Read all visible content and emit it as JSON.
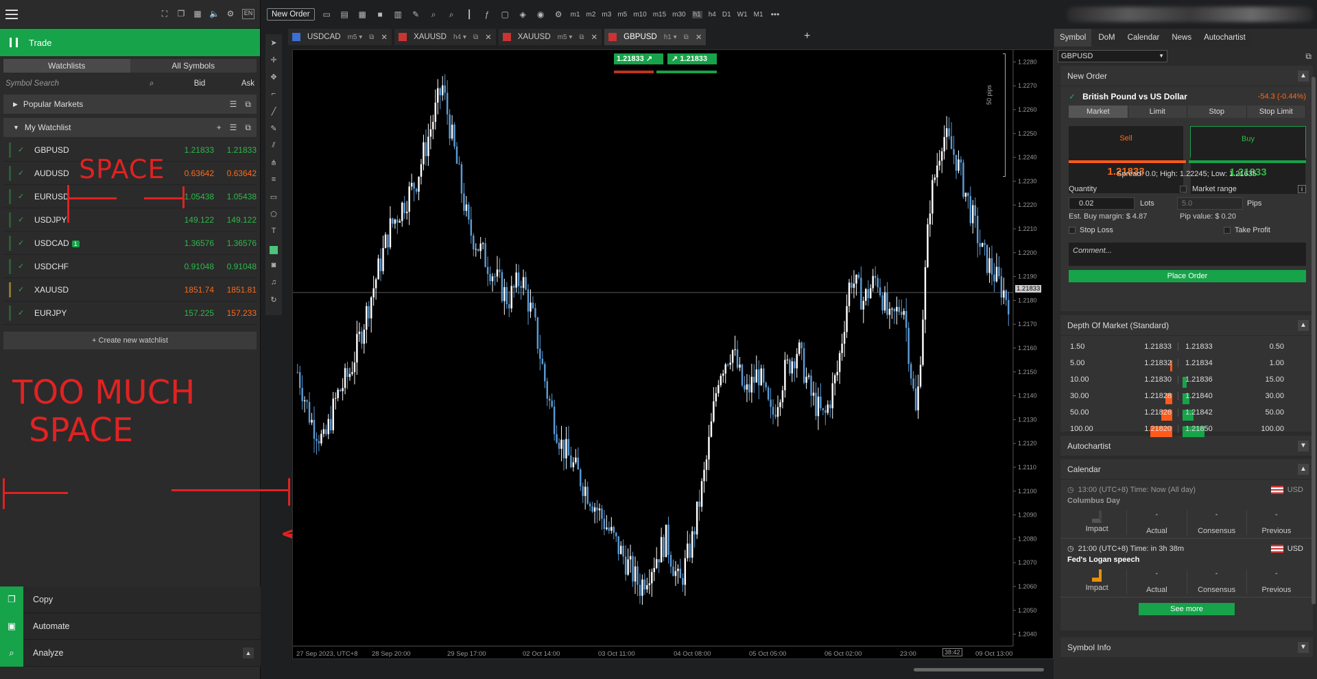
{
  "left": {
    "trade_label": "Trade",
    "tabs": [
      "Watchlists",
      "All Symbols"
    ],
    "search_placeholder": "Symbol Search",
    "bid_header": "Bid",
    "ask_header": "Ask",
    "popular_markets": "Popular Markets",
    "my_watchlist": "My Watchlist",
    "rows": [
      {
        "sym": "GBPUSD",
        "bid": "1.21833",
        "ask": "1.21833",
        "dir": "up",
        "badge": ""
      },
      {
        "sym": "AUDUSD",
        "bid": "0.63642",
        "ask": "0.63642",
        "dir": "dn",
        "badge": ""
      },
      {
        "sym": "EURUSD",
        "bid": "1.05438",
        "ask": "1.05438",
        "dir": "up",
        "badge": ""
      },
      {
        "sym": "USDJPY",
        "bid": "149.122",
        "ask": "149.122",
        "dir": "up",
        "badge": ""
      },
      {
        "sym": "USDCAD",
        "bid": "1.36576",
        "ask": "1.36576",
        "dir": "up",
        "badge": "1"
      },
      {
        "sym": "USDCHF",
        "bid": "0.91048",
        "ask": "0.91048",
        "dir": "up",
        "badge": ""
      },
      {
        "sym": "XAUUSD",
        "bid": "1851.74",
        "ask": "1851.81",
        "dir": "dn",
        "badge": ""
      },
      {
        "sym": "EURJPY",
        "bid": "157.225",
        "ask": "157.233",
        "dir": "mix",
        "badge": ""
      }
    ],
    "create_watchlist": "+ Create new watchlist",
    "bottom": [
      "Copy",
      "Automate",
      "Analyze"
    ],
    "lang": "EN"
  },
  "annotations": {
    "space": "SPACE",
    "too_much": "TOO MUCH",
    "space2": "SPACE"
  },
  "toolbar": {
    "new_order": "New Order",
    "timeframes": [
      "m1",
      "m2",
      "m3",
      "m5",
      "m10",
      "m15",
      "m30",
      "h1",
      "h4",
      "D1",
      "W1",
      "M1"
    ]
  },
  "chart_tabs": [
    {
      "sym": "USDCAD",
      "tf": "m5"
    },
    {
      "sym": "XAUUSD",
      "tf": "h4"
    },
    {
      "sym": "XAUUSD",
      "tf": "m5"
    },
    {
      "sym": "GBPUSD",
      "tf": "h1"
    }
  ],
  "chart_data": {
    "type": "candlestick",
    "bid_box": "1.21833",
    "ask_box": "1.21833",
    "current_price": "1.21833",
    "pips_label": "50 pips",
    "corner_label": "38:42",
    "y_ticks": [
      "1.2280",
      "1.2270",
      "1.2260",
      "1.2250",
      "1.2240",
      "1.2230",
      "1.2220",
      "1.2210",
      "1.2200",
      "1.2190",
      "1.2180",
      "1.2170",
      "1.2160",
      "1.2150",
      "1.2140",
      "1.2130",
      "1.2120",
      "1.2110",
      "1.2100",
      "1.2090",
      "1.2080",
      "1.2070",
      "1.2060",
      "1.2050",
      "1.2040"
    ],
    "x_ticks": [
      "27 Sep 2023, UTC+8",
      "28 Sep 20:00",
      "29 Sep 17:00",
      "02 Oct 14:00",
      "03 Oct 11:00",
      "04 Oct 08:00",
      "05 Oct 05:00",
      "06 Oct 02:00",
      "23:00",
      "09 Oct 13:00"
    ],
    "ylim": [
      1.2035,
      1.2285
    ],
    "close_path": [
      1.215,
      1.213,
      1.212,
      1.214,
      1.215,
      1.217,
      1.219,
      1.221,
      1.222,
      1.223,
      1.225,
      1.227,
      1.224,
      1.221,
      1.22,
      1.219,
      1.218,
      1.219,
      1.217,
      1.214,
      1.212,
      1.211,
      1.21,
      1.209,
      1.208,
      1.207,
      1.206,
      1.207,
      1.208,
      1.206,
      1.208,
      1.211,
      1.215,
      1.216,
      1.214,
      1.215,
      1.213,
      1.215,
      1.216,
      1.214,
      1.213,
      1.215,
      1.219,
      1.218,
      1.219,
      1.217,
      1.218,
      1.213,
      1.222,
      1.225,
      1.224,
      1.222,
      1.22,
      1.219,
      1.218
    ]
  },
  "right": {
    "tabs": [
      "Symbol",
      "DoM",
      "Calendar",
      "News",
      "Autochartist"
    ],
    "symbol_select": "GBPUSD",
    "new_order": "New Order",
    "symbol_name": "British Pound vs US Dollar",
    "change": "-54.3 (-0.44%)",
    "order_tabs": [
      "Market",
      "Limit",
      "Stop",
      "Stop Limit"
    ],
    "sell_label": "Sell",
    "sell_price": "1.21833",
    "buy_label": "Buy",
    "buy_price": "1.21833",
    "spread": "Spread: 0.0; High: 1.22245; Low: 1.21635",
    "quantity": "Quantity",
    "market_range": "Market range",
    "qty_value": "0.02",
    "lots": "Lots",
    "pips_value_input": "5.0",
    "pips": "Pips",
    "margin": "Est. Buy margin: $ 4.87",
    "pip_value": "Pip value: $ 0.20",
    "stop_loss": "Stop Loss",
    "take_profit": "Take Profit",
    "comment": "Comment...",
    "place_order": "Place Order",
    "dom_title": "Depth Of Market (Standard)",
    "dom_rows": [
      {
        "bv": "1.50",
        "bp": "1.21833",
        "ap": "1.21833",
        "av": "0.50",
        "bw": 0,
        "aw": 0
      },
      {
        "bv": "5.00",
        "bp": "1.21832",
        "ap": "1.21834",
        "av": "1.00",
        "bw": 0.05,
        "aw": 0
      },
      {
        "bv": "10.00",
        "bp": "1.21830",
        "ap": "1.21836",
        "av": "15.00",
        "bw": 0,
        "aw": 0.1
      },
      {
        "bv": "30.00",
        "bp": "1.21828",
        "ap": "1.21840",
        "av": "30.00",
        "bw": 0.15,
        "aw": 0.15
      },
      {
        "bv": "50.00",
        "bp": "1.21826",
        "ap": "1.21842",
        "av": "50.00",
        "bw": 0.25,
        "aw": 0.25
      },
      {
        "bv": "100.00",
        "bp": "1.21820",
        "ap": "1.21850",
        "av": "100.00",
        "bw": 0.5,
        "aw": 0.5
      }
    ],
    "autochartist": "Autochartist",
    "calendar": "Calendar",
    "events": [
      {
        "time": "13:00  (UTC+8)  Time:  Now (All day)",
        "name": "Columbus Day",
        "cur": "USD",
        "impact": "Impact",
        "actual": "Actual",
        "consensus": "Consensus",
        "previous": "Previous",
        "dash": "-"
      },
      {
        "time": "21:00  (UTC+8)  Time:  in 3h 38m",
        "name": "Fed's Logan speech",
        "cur": "USD",
        "impact": "Impact",
        "actual": "Actual",
        "consensus": "Consensus",
        "previous": "Previous",
        "dash": "-"
      }
    ],
    "see_more": "See more",
    "symbol_info": "Symbol Info"
  }
}
